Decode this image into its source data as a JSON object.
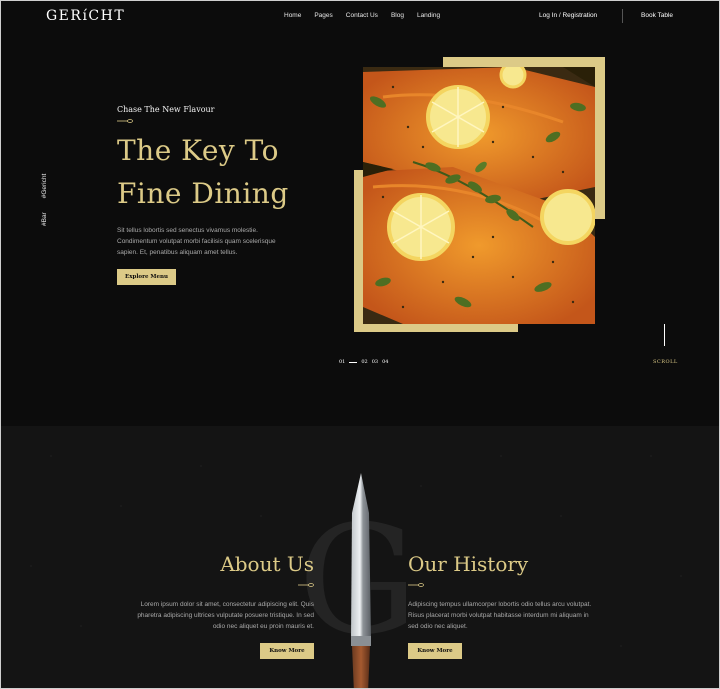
{
  "nav": {
    "logo": "GERíCHT",
    "links": [
      "Home",
      "Pages",
      "Contact Us",
      "Blog",
      "Landing"
    ],
    "login": "Log In / Registration",
    "book": "Book Table"
  },
  "social": [
    "#Bar",
    "#Gericht"
  ],
  "hero": {
    "subtitle": "Chase The New Flavour",
    "title_line1": "The Key To",
    "title_line2": "Fine Dining",
    "description_line1": "Sit tellus lobortis sed senectus vivamus molestie.",
    "description_line2": "Condimentum volutpat morbi facilisis quam scelerisque",
    "description_line3": "sapien. Et, penatibus aliquam amet tellus.",
    "button": "Explore Menu",
    "slides": [
      "01",
      "02",
      "03",
      "04"
    ],
    "scroll": "SCROLL"
  },
  "about": {
    "title": "About Us",
    "desc_line1": "Lorem ipsum dolor sit amet, consectetur adipiscing elit. Quis",
    "desc_line2": "pharetra adipiscing ultrices vulputate posuere tristique. In sed",
    "desc_line3": "odio nec aliquet eu proin mauris et.",
    "button": "Know More",
    "watermark": "G"
  },
  "history": {
    "title": "Our History",
    "desc_line1": "Adipiscing tempus ullamcorper lobortis odio tellus arcu volutpat.",
    "desc_line2": "Risus placerat morbi volutpat habitasse interdum mi aliquam in",
    "desc_line3": "sed odio nec aliquet.",
    "button": "Know More"
  },
  "colors": {
    "accent": "#dcca87",
    "background": "#0c0c0c",
    "muted_text": "#aaaaaa"
  }
}
